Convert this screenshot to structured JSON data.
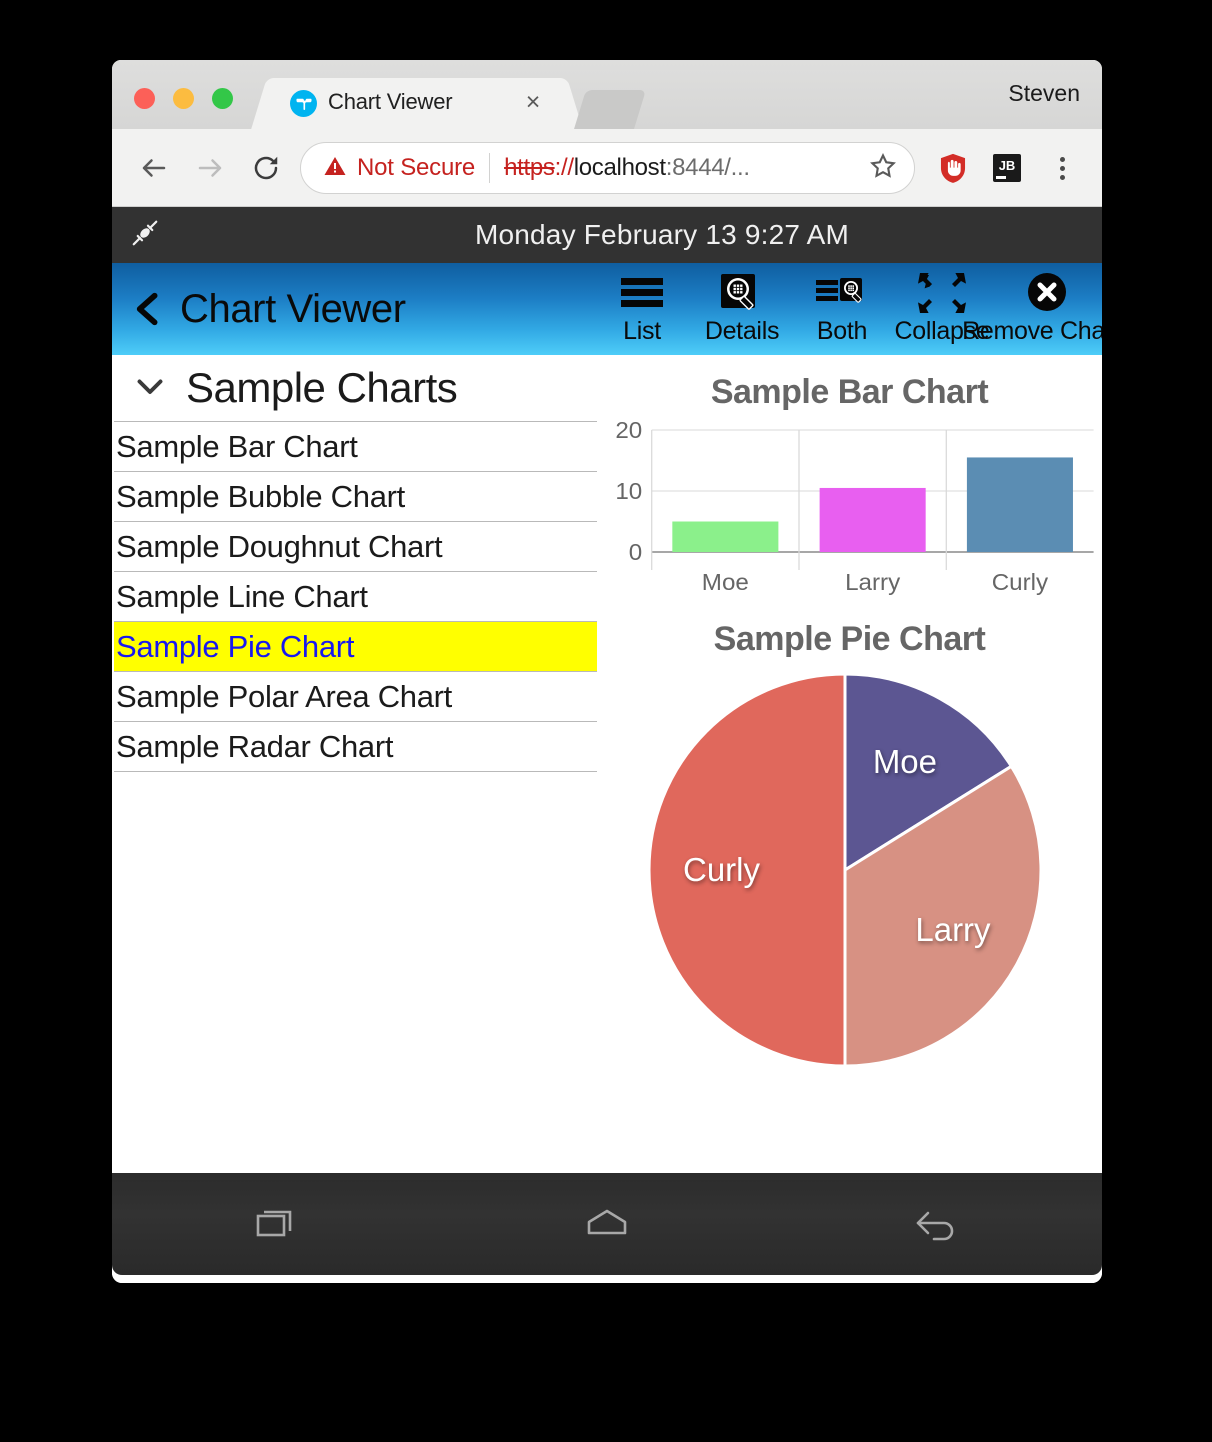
{
  "browser": {
    "profile_name": "Steven",
    "tab": {
      "title": "Chart Viewer",
      "favicon": "vaadin-logo-icon",
      "close": "×"
    },
    "omnibox": {
      "security_label": "Not Secure",
      "url_scheme": "https",
      "url_scheme_rest": "://",
      "url_host": "localhost",
      "url_port": ":8444/...",
      "full_url": "https://localhost:8444/..."
    },
    "nav": {
      "back": "back-arrow-icon",
      "forward": "forward-arrow-icon",
      "reload": "reload-icon"
    },
    "extensions": [
      "adblock-icon",
      "jetbrains-icon"
    ],
    "menu": "three-dot-menu-icon"
  },
  "device": {
    "status_bar": {
      "clock": "Monday February 13 9:27 AM",
      "plug_icon": "plug-icon"
    },
    "nav_keys": {
      "recents": "recents-icon",
      "home": "home-icon",
      "back": "back-icon"
    }
  },
  "app": {
    "title": "Chart Viewer",
    "back_label": "back-chevron-icon",
    "toolbar": [
      {
        "label": "List",
        "icon": "list-icon"
      },
      {
        "label": "Details",
        "icon": "details-magnifier-icon"
      },
      {
        "label": "Both",
        "icon": "both-split-icon"
      },
      {
        "label": "Collapse",
        "icon": "collapse-arrows-icon"
      },
      {
        "label": "Remove Charts",
        "icon": "remove-circle-x-icon"
      }
    ],
    "sidebar": {
      "group_title": "Sample Charts",
      "expanded": true,
      "items": [
        {
          "label": "Sample Bar Chart",
          "selected": false
        },
        {
          "label": "Sample Bubble Chart",
          "selected": false
        },
        {
          "label": "Sample Doughnut Chart",
          "selected": false
        },
        {
          "label": "Sample Line Chart",
          "selected": false
        },
        {
          "label": "Sample Pie Chart",
          "selected": true
        },
        {
          "label": "Sample Polar Area Chart",
          "selected": false
        },
        {
          "label": "Sample Radar Chart",
          "selected": false
        }
      ],
      "selection_bg": "#ffff00",
      "selection_fg": "#1818f0"
    }
  },
  "chart_data": [
    {
      "type": "bar",
      "title": "Sample Bar Chart",
      "categories": [
        "Moe",
        "Larry",
        "Curly"
      ],
      "values": [
        5,
        10.5,
        15.5
      ],
      "colors": [
        "#8bf08b",
        "#e85ff0",
        "#5b8db3"
      ],
      "xlabel": "",
      "ylabel": "",
      "ylim": [
        0,
        20
      ],
      "yticks": [
        0,
        10,
        20
      ],
      "grid": true,
      "legend": "none"
    },
    {
      "type": "pie",
      "title": "Sample Pie Chart",
      "labels": [
        "Moe",
        "Larry",
        "Curly"
      ],
      "values": [
        5,
        10.5,
        15.5
      ],
      "percents": [
        16.1,
        33.9,
        50.0
      ],
      "colors": [
        "#5c5692",
        "#d79183",
        "#e0685c"
      ],
      "start_angle_deg": 0,
      "legend": "none",
      "data_labels": true
    }
  ]
}
